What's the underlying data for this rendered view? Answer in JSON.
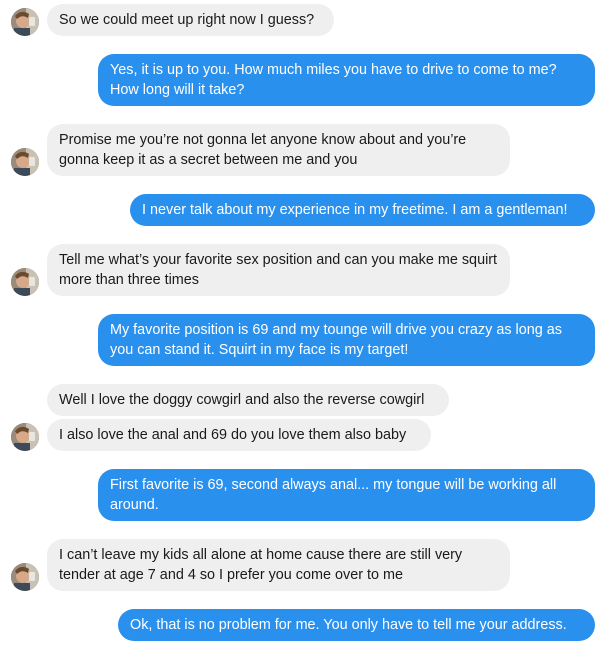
{
  "conversation": {
    "messages": [
      {
        "sender": "contact",
        "text": "So we could meet up right now I guess?"
      },
      {
        "sender": "me",
        "text": "Yes, it is up to you. How much miles you have to drive to come to me? How long will it take?"
      },
      {
        "sender": "contact",
        "text": "Promise me you’re not gonna let anyone know about and you’re gonna keep it as a secret between me and you"
      },
      {
        "sender": "me",
        "text": "I never talk about my experience in my freetime. I am a gentleman!"
      },
      {
        "sender": "contact",
        "text": "Tell me what’s your favorite sex position and can you make me squirt more than three times"
      },
      {
        "sender": "me",
        "text": "My favorite position is 69 and my tounge will drive you crazy as long as you can stand it. Squirt in my face is my target!"
      },
      {
        "sender": "contact",
        "text": "Well I love the doggy cowgirl and also the reverse cowgirl"
      },
      {
        "sender": "contact",
        "text": "I also love the anal and 69 do you love them also baby"
      },
      {
        "sender": "me",
        "text": "First favorite is 69, second always anal... my tongue will be working all around."
      },
      {
        "sender": "contact",
        "text": "I can’t leave my kids all alone at home cause there are still very tender at age 7 and 4 so I prefer you come over to me"
      },
      {
        "sender": "me",
        "text": "Ok, that is no problem for me. You only have to tell me your address."
      }
    ]
  },
  "colors": {
    "incoming_bubble": "#efefef",
    "outgoing_bubble": "#2a90ee",
    "incoming_text": "#1a1a1a",
    "outgoing_text": "#ffffff"
  },
  "icons": {
    "avatar": "contact-avatar-photo"
  }
}
